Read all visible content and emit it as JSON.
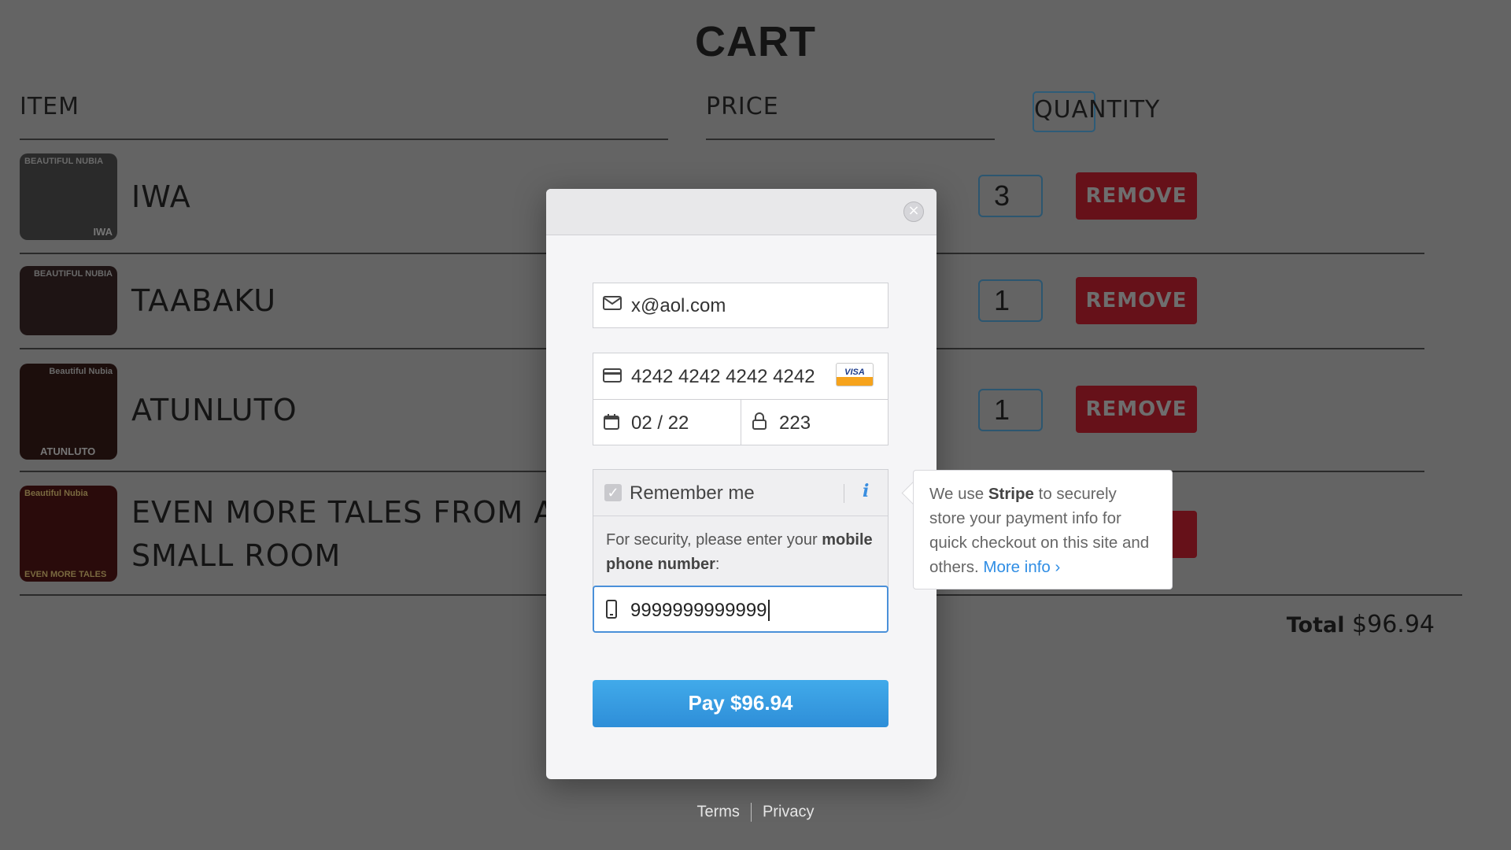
{
  "cart": {
    "title": "CART",
    "headers": {
      "item": "ITEM",
      "price": "PRICE",
      "quantity": "QUANTITY"
    },
    "items": [
      {
        "name": "IWA",
        "thumb_top": "BEAUTIFUL NUBIA",
        "thumb_bottom": "IWA",
        "quantity": "3",
        "remove_label": "REMOVE"
      },
      {
        "name": "TAABAKU",
        "thumb_top": "BEAUTIFUL NUBIA",
        "thumb_bottom": "",
        "quantity": "1",
        "remove_label": "REMOVE"
      },
      {
        "name": "ATUNLUTO",
        "thumb_top": "Beautiful Nubia",
        "thumb_bottom": "ATUNLUTO",
        "quantity": "1",
        "remove_label": "REMOVE"
      },
      {
        "name": "EVEN MORE TALES FROM A SMALL ROOM",
        "name_line1": "EVEN MORE TALES FROM A",
        "name_line2": "SMALL ROOM",
        "thumb_top": "Beautiful Nubia",
        "thumb_bottom": "EVEN MORE TALES"
      }
    ],
    "total_label": "Total",
    "total_value": "$96.94"
  },
  "checkout": {
    "email": "x@aol.com",
    "card_number": "4242 4242 4242 4242",
    "card_brand": "VISA",
    "expiry": "02 / 22",
    "cvc": "223",
    "remember_label": "Remember me",
    "security_text_1": "For security, please enter your",
    "security_text_bold": "mobile phone number",
    "security_text_2": ":",
    "phone": "9999999999999",
    "pay_label": "Pay $96.94",
    "info_icon": "i"
  },
  "tooltip": {
    "pre": "We use ",
    "brand": "Stripe",
    "post": " to securely store your payment info for quick checkout on this site and others. ",
    "more": "More info ›"
  },
  "footer": {
    "terms": "Terms",
    "privacy": "Privacy"
  },
  "colors": {
    "overlay_bg": "#646464",
    "remove_btn": "#661119",
    "pay_btn": "#2e8ed8",
    "link": "#2f8de4"
  }
}
